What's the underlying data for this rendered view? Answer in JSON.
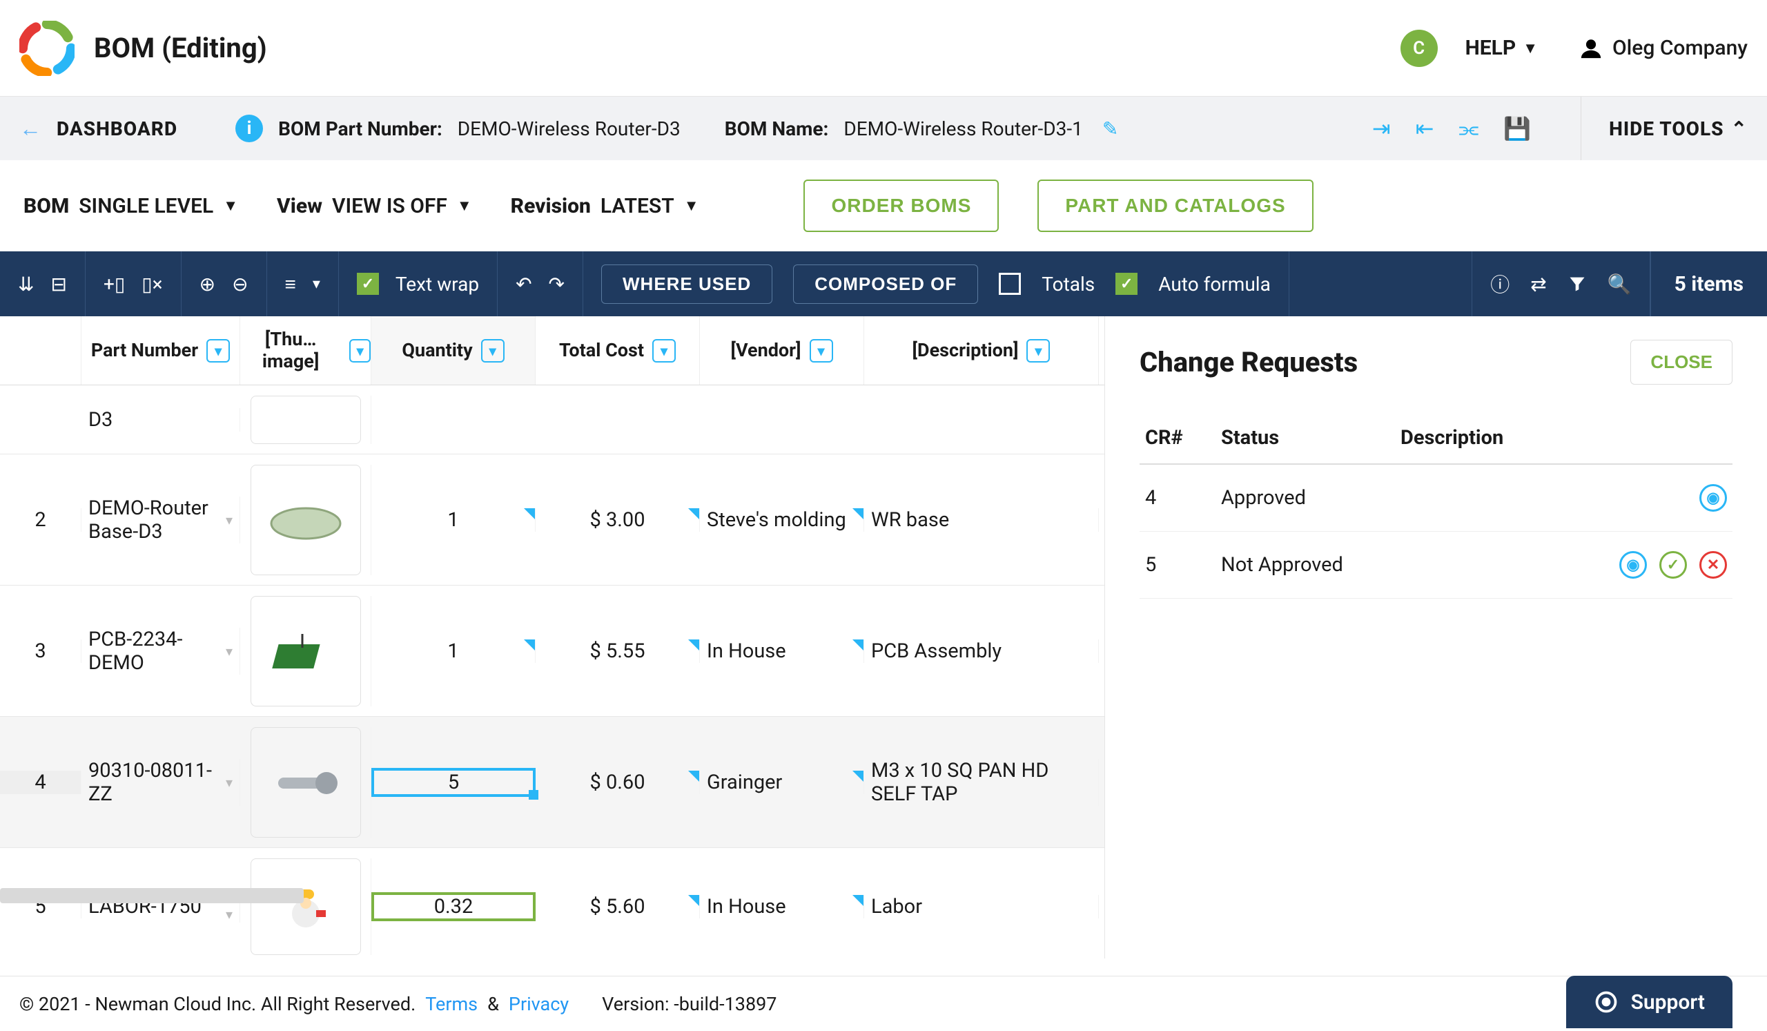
{
  "header": {
    "title": "BOM (Editing)",
    "avatar_letter": "C",
    "help_label": "HELP",
    "user_name": "Oleg Company"
  },
  "crumb": {
    "back_label": "DASHBOARD",
    "partnum_label": "BOM Part Number:",
    "partnum_value": "DEMO-Wireless Router-D3",
    "name_label": "BOM Name:",
    "name_value": "DEMO-Wireless Router-D3-1",
    "hide_tools": "HIDE TOOLS"
  },
  "viewbar": {
    "bom": "BOM",
    "bom_mode": "SINGLE LEVEL",
    "view": "View",
    "view_mode": "VIEW IS OFF",
    "rev": "Revision",
    "rev_mode": "LATEST",
    "order": "ORDER BOMS",
    "catalog": "PART AND CATALOGS"
  },
  "darkbar": {
    "textwrap": "Text wrap",
    "where": "WHERE USED",
    "composed": "COMPOSED OF",
    "totals": "Totals",
    "auto": "Auto formula",
    "count": "5 items"
  },
  "columns": {
    "part": "Part Number",
    "thumb": "[Thu… image]",
    "qty": "Quantity",
    "cost": "Total Cost",
    "vendor": "[Vendor]",
    "desc": "[Description]"
  },
  "rows": [
    {
      "n": "",
      "part": "D3",
      "qty": "",
      "cost": "",
      "vendor": "",
      "desc": ""
    },
    {
      "n": "2",
      "part": "DEMO-Router Base-D3",
      "qty": "1",
      "cost": "$ 3.00",
      "vendor": "Steve's molding",
      "desc": "WR base"
    },
    {
      "n": "3",
      "part": "PCB-2234-DEMO",
      "qty": "1",
      "cost": "$ 5.55",
      "vendor": "In House",
      "desc": "PCB Assembly"
    },
    {
      "n": "4",
      "part": "90310-08011-ZZ",
      "qty": "5",
      "cost": "$ 0.60",
      "vendor": "Grainger",
      "desc": "M3 x 10 SQ PAN HD SELF TAP"
    },
    {
      "n": "5",
      "part": "LABOR-1750",
      "qty": "0.32",
      "cost": "$ 5.60",
      "vendor": "In House",
      "desc": "Labor"
    }
  ],
  "cr": {
    "title": "Change Requests",
    "close": "CLOSE",
    "col_num": "CR#",
    "col_status": "Status",
    "col_desc": "Description",
    "rows": [
      {
        "n": "4",
        "status": "Approved",
        "actions": [
          "view"
        ]
      },
      {
        "n": "5",
        "status": "Not Approved",
        "actions": [
          "view",
          "approve",
          "reject"
        ]
      }
    ]
  },
  "footer": {
    "copy": "© 2021 - Newman Cloud Inc. All Right Reserved.",
    "terms": "Terms",
    "amp": "&",
    "privacy": "Privacy",
    "version": "Version: -build-13897",
    "support": "Support"
  }
}
